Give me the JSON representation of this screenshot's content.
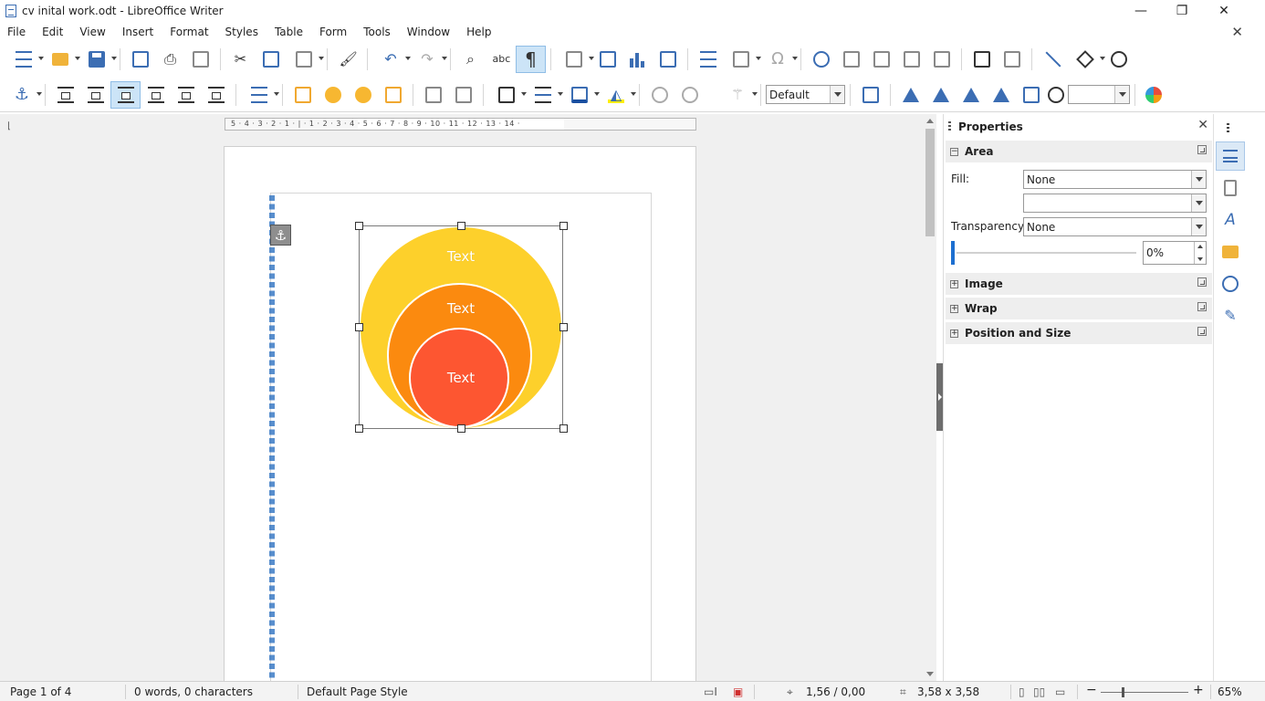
{
  "app": {
    "window_title": "cv inital work.odt - LibreOffice Writer"
  },
  "window_controls": {
    "minimize": "—",
    "restore": "❐",
    "close": "✕",
    "doc_close": "✕"
  },
  "menubar": {
    "items": [
      "File",
      "Edit",
      "View",
      "Insert",
      "Format",
      "Styles",
      "Table",
      "Form",
      "Tools",
      "Window",
      "Help"
    ]
  },
  "toolbar": {
    "style_box": "Default",
    "color_box": ""
  },
  "ruler": {
    "labels": "5 · 4 · 3 · 2 · 1 · | · 1 · 2 · 3 · 4 · 5 · 6 · 7 · 8 · 9 · 10 · 11 · 12 · 13 · 14 ·"
  },
  "graphic": {
    "outer_text": "Text",
    "middle_text": "Text",
    "inner_text": "Text",
    "colors": {
      "outer": "#fdd02b",
      "middle": "#fb8a0f",
      "inner": "#fd5631"
    }
  },
  "sidebar": {
    "title": "Properties",
    "area": {
      "title": "Area",
      "fill_label": "Fill:",
      "fill_value": "None",
      "fill_sub_value": "",
      "transparency_label": "Transparency:",
      "transparency_value": "None",
      "transparency_percent": "0%"
    },
    "panels": [
      "Image",
      "Wrap",
      "Position and Size"
    ]
  },
  "statusbar": {
    "page": "Page 1 of 4",
    "words": "0 words, 0 characters",
    "page_style": "Default Page Style",
    "position": "1,56 / 0,00",
    "size": "3,58 x 3,58",
    "zoom": "65%",
    "zoom_minus": "−",
    "zoom_plus": "+"
  }
}
